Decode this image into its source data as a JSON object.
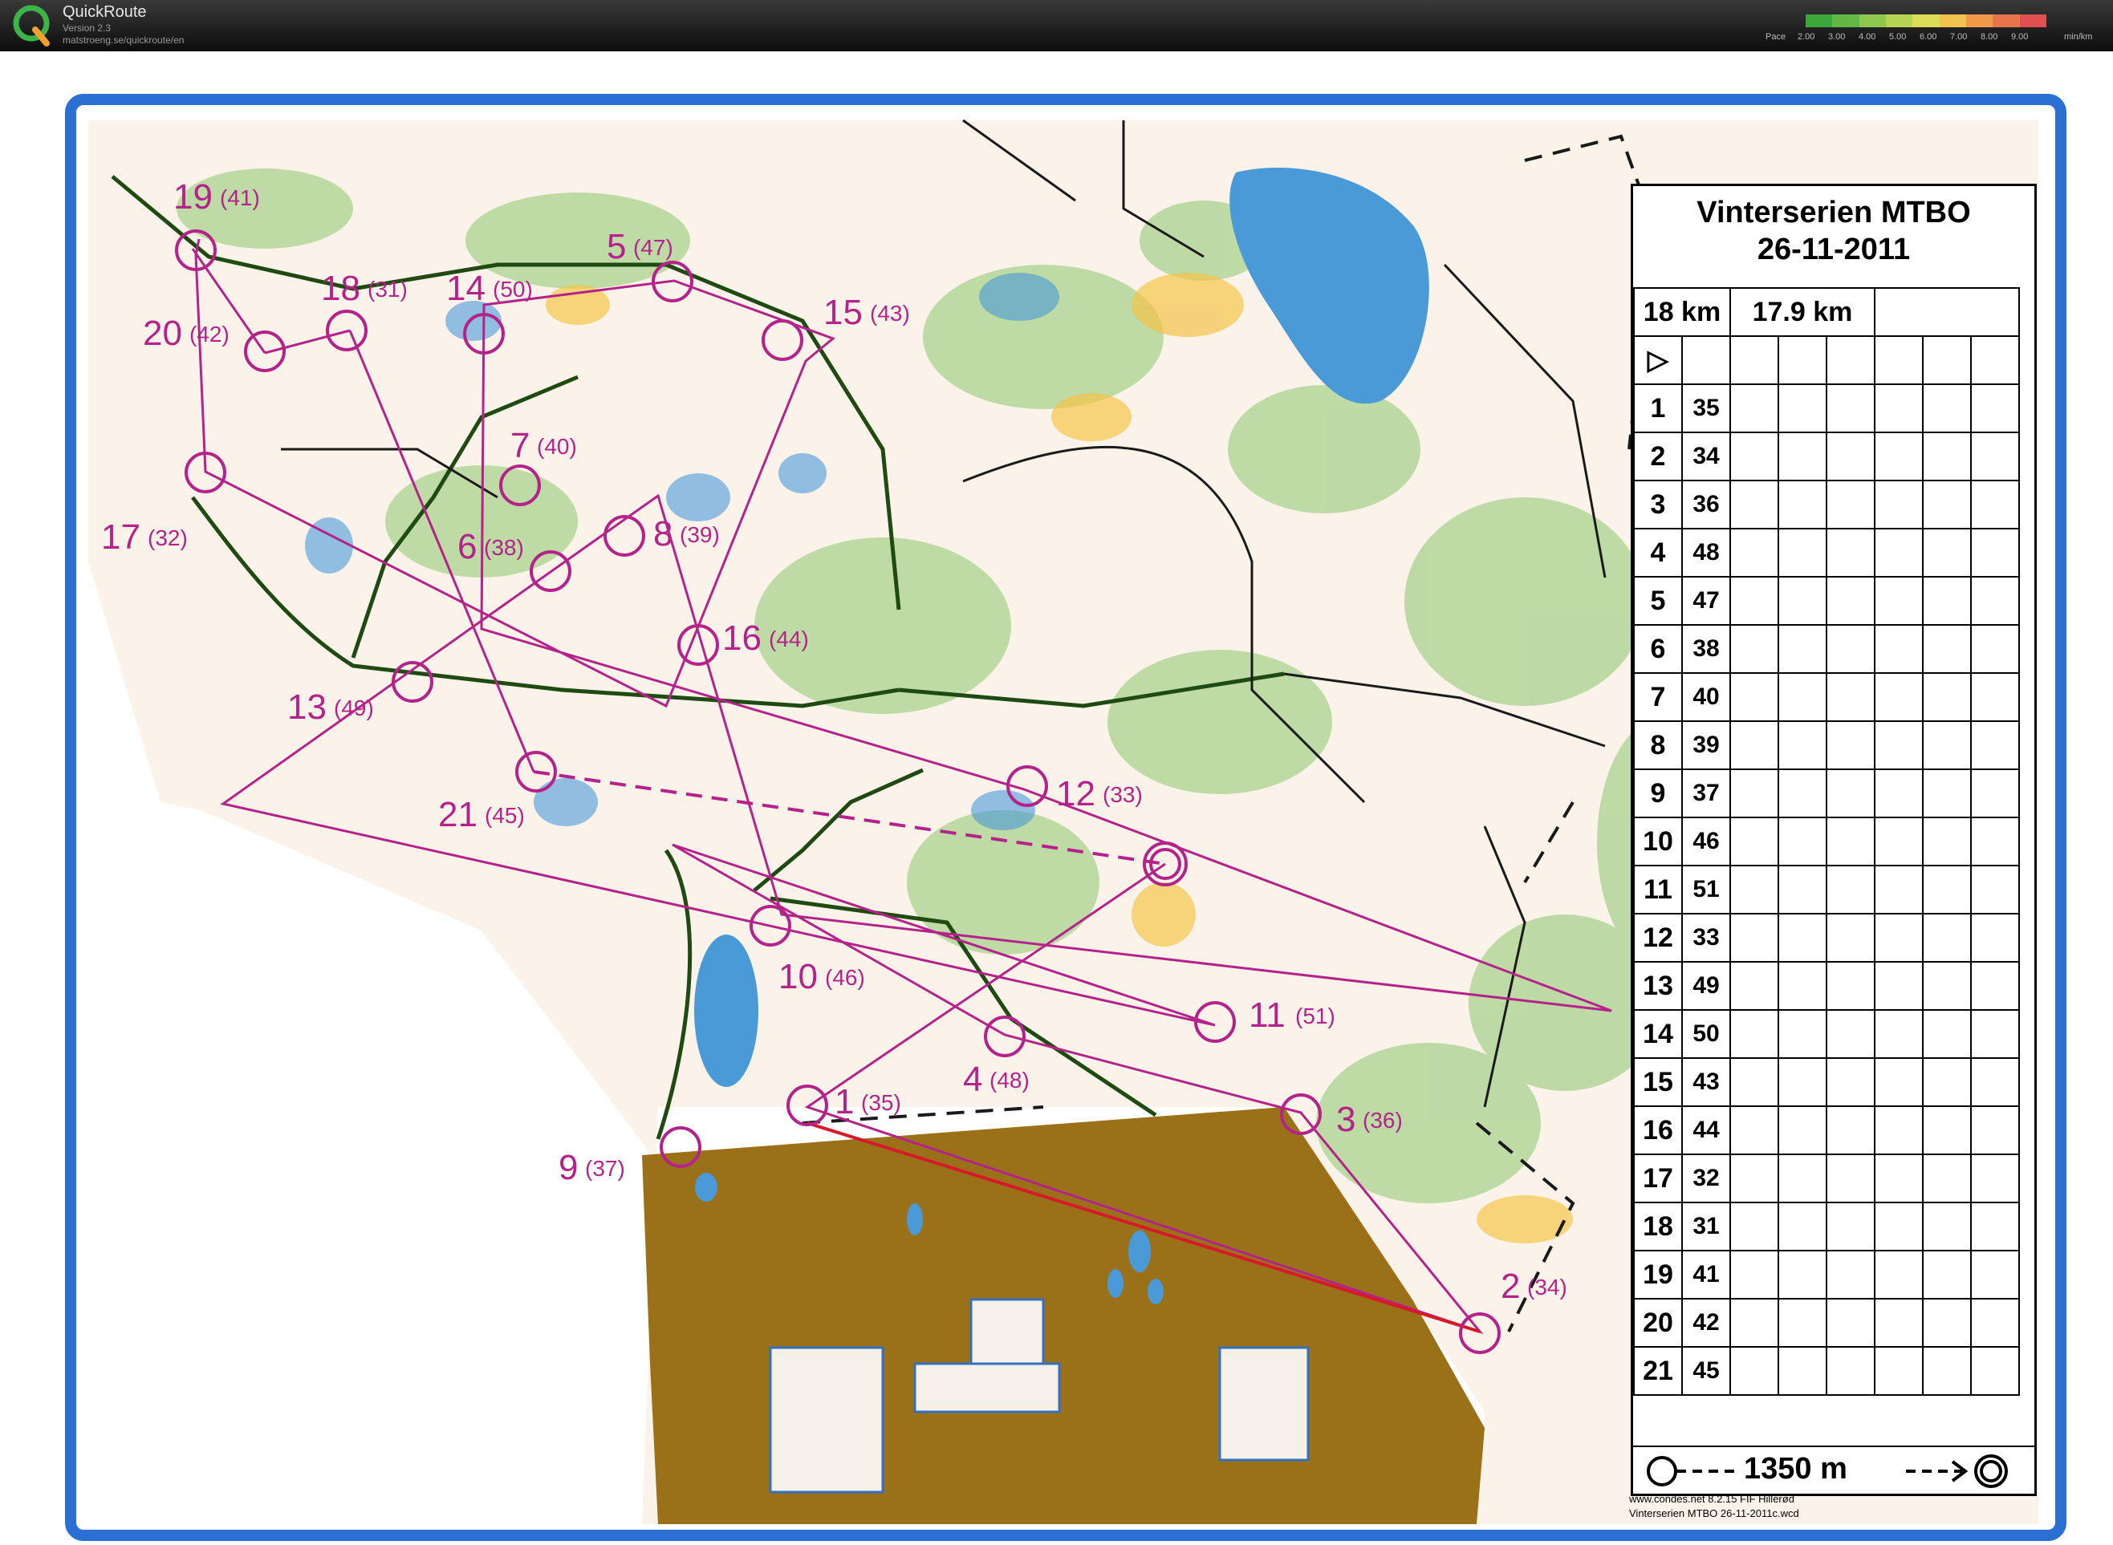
{
  "app": {
    "name": "QuickRoute",
    "version": "Version 2.3",
    "url": "matstroeng.se/quickroute/en"
  },
  "pace_legend": {
    "label": "Pace",
    "ticks": [
      "2.00",
      "3.00",
      "4.00",
      "5.00",
      "6.00",
      "7.00",
      "8.00",
      "9.00"
    ],
    "unit": "min/km",
    "colors": [
      "#3aa83a",
      "#62b845",
      "#8cc84e",
      "#b5d452",
      "#dcdc55",
      "#f0c24e",
      "#f09a4a",
      "#e8744a",
      "#e05050"
    ]
  },
  "map": {
    "background": "#fbf7f0",
    "frame_color": "#2b6fd4",
    "course_color": "#b4238a",
    "title": "Vinterserien MTBO",
    "date": "26-11-2011",
    "distances": [
      "18 km",
      "17.9 km"
    ],
    "controls": [
      {
        "number": "1",
        "code": "35"
      },
      {
        "number": "2",
        "code": "34"
      },
      {
        "number": "3",
        "code": "36"
      },
      {
        "number": "4",
        "code": "48"
      },
      {
        "number": "5",
        "code": "47"
      },
      {
        "number": "6",
        "code": "38"
      },
      {
        "number": "7",
        "code": "40"
      },
      {
        "number": "8",
        "code": "39"
      },
      {
        "number": "9",
        "code": "37"
      },
      {
        "number": "10",
        "code": "46"
      },
      {
        "number": "11",
        "code": "51"
      },
      {
        "number": "12",
        "code": "33"
      },
      {
        "number": "13",
        "code": "49"
      },
      {
        "number": "14",
        "code": "50"
      },
      {
        "number": "15",
        "code": "43"
      },
      {
        "number": "16",
        "code": "44"
      },
      {
        "number": "17",
        "code": "32"
      },
      {
        "number": "18",
        "code": "31"
      },
      {
        "number": "19",
        "code": "41"
      },
      {
        "number": "20",
        "code": "42"
      },
      {
        "number": "21",
        "code": "45"
      }
    ],
    "finish_distance": "1350 m",
    "credit_line_1": "www.condes.net 8.2.15 FIF Hillerød",
    "credit_line_2": "Vinterserien MTBO 26-11-2011c.wcd"
  }
}
